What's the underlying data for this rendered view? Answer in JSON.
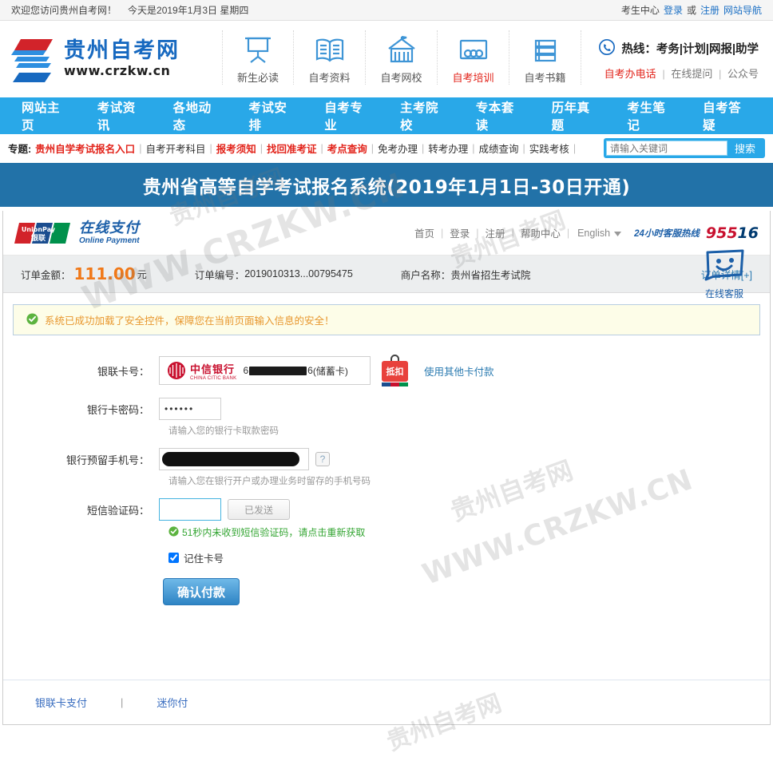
{
  "topbar": {
    "welcome": "欢迎您访问贵州自考网！",
    "date": "今天是2019年1月3日 星期四",
    "center": "考生中心",
    "login": "登录",
    "or": "或",
    "register": "注册",
    "sitemap": "网站导航"
  },
  "header": {
    "logo_zh": "贵州自考网",
    "logo_en": "www.crzkw.cn",
    "nav_icons": [
      {
        "label": "新生必读",
        "icon": "easel-icon",
        "active": false
      },
      {
        "label": "自考资料",
        "icon": "open-book-icon",
        "active": false
      },
      {
        "label": "自考网校",
        "icon": "school-building-icon",
        "active": false
      },
      {
        "label": "自考培训",
        "icon": "classroom-icon",
        "active": true
      },
      {
        "label": "自考书籍",
        "icon": "stacked-books-icon",
        "active": false
      }
    ],
    "hotline_title": "热线：考务|计划|网报|助学",
    "hotline_links": [
      "自考办电话",
      "在线提问",
      "公众号"
    ]
  },
  "mainnav": [
    "网站主页",
    "考试资讯",
    "各地动态",
    "考试安排",
    "自考专业",
    "主考院校",
    "专本套读",
    "历年真题",
    "考生笔记",
    "自考答疑"
  ],
  "subbar": {
    "topic_label": "专题:",
    "items": [
      {
        "text": "贵州自学考试报名入口",
        "style": "red"
      },
      {
        "text": "自考开考科目",
        "style": "normal"
      },
      {
        "text": "报考须知",
        "style": "red"
      },
      {
        "text": "找回准考证",
        "style": "red"
      },
      {
        "text": "考点查询",
        "style": "red"
      },
      {
        "text": "免考办理",
        "style": "normal"
      },
      {
        "text": "转考办理",
        "style": "normal"
      },
      {
        "text": "成绩查询",
        "style": "normal"
      },
      {
        "text": "实践考核",
        "style": "normal"
      }
    ],
    "search_placeholder": "请输入关键词",
    "search_button": "搜索"
  },
  "banner": {
    "title": "贵州省高等自学考试报名系统(2019年1月1日-30日开通)"
  },
  "payment": {
    "unionpay_brand": "UnionPay",
    "unionpay_brand_zh": "银联",
    "online_zh": "在线支付",
    "online_en": "Online Payment",
    "head_links": [
      "首页",
      "登录",
      "注册",
      "帮助中心"
    ],
    "language": "English",
    "service_label": "24小时客服热线",
    "service_number_red": "955",
    "service_number_blue": "16",
    "order": {
      "amount_label": "订单金额：",
      "amount": "111.00",
      "unit": "元",
      "no_label": "订单编号：",
      "no": "2019010313...00795475",
      "merchant_label": "商户名称：",
      "merchant": "贵州省招生考试院",
      "detail_link": "订单详情[+]"
    },
    "alert": "系统已成功加载了安全控件，保障您在当前页面输入信息的安全！",
    "form": {
      "card_label": "银联卡号：",
      "bank_name": "中信银行",
      "bank_name_en": "CHINA CITIC BANK",
      "card_prefix": "6",
      "card_suffix": "6",
      "card_type": "(储蓄卡)",
      "discount_badge": "抵扣",
      "other_card_link": "使用其他卡付款",
      "password_label": "银行卡密码：",
      "password_value": "••••••",
      "password_hint": "请输入您的银行卡取款密码",
      "phone_label": "银行预留手机号：",
      "phone_hint": "请输入您在银行开户或办理业务时留存的手机号码",
      "help_icon": "?",
      "sms_label": "短信验证码：",
      "sms_value": "",
      "sms_button": "已发送",
      "sms_note": "51秒内未收到短信验证码，请点击重新获取",
      "remember_label": "记住卡号",
      "submit_label": "确认付款"
    },
    "online_service": "在线客服",
    "footer_tabs": [
      "银联卡支付",
      "迷你付"
    ]
  },
  "watermarks": {
    "zh": "贵州自考网",
    "en": "WWW.CRZKW.CN"
  }
}
